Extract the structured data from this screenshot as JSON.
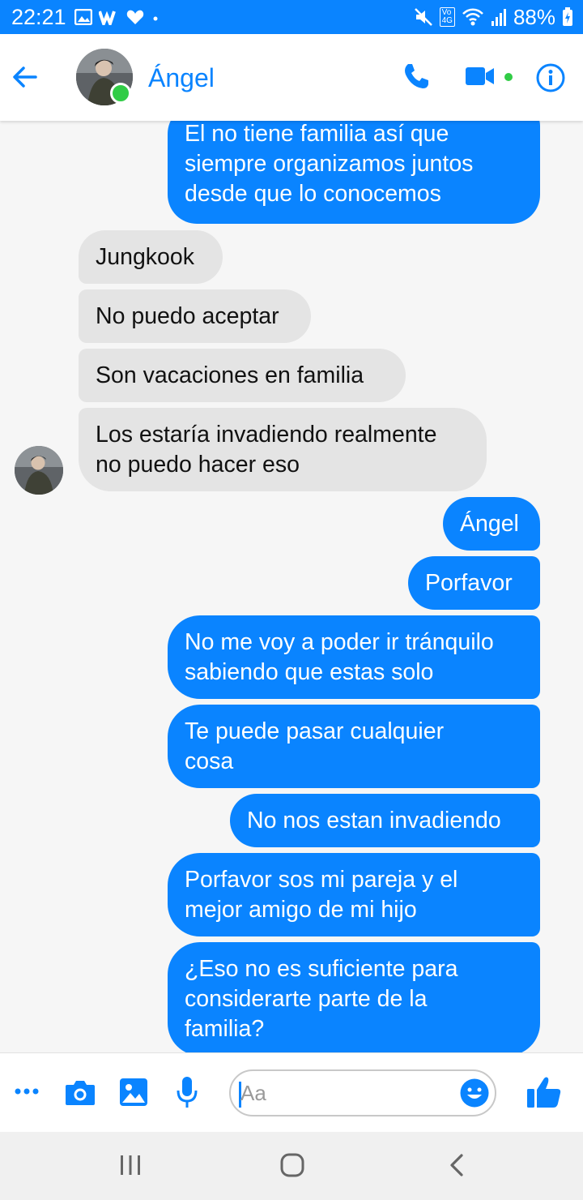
{
  "status_bar": {
    "time": "22:21",
    "battery": "88%",
    "network": "4G",
    "network_sub": "Vo"
  },
  "header": {
    "contact_name": "Ángel",
    "online": true
  },
  "messages": [
    {
      "direction": "outgoing",
      "lines": [
        "El no tiene familia así que",
        "siempre organizamos juntos",
        "desde que lo conocemos"
      ]
    },
    {
      "direction": "incoming",
      "lines": [
        "Jungkook"
      ]
    },
    {
      "direction": "incoming",
      "lines": [
        "No puedo aceptar"
      ]
    },
    {
      "direction": "incoming",
      "lines": [
        "Son vacaciones en familia"
      ]
    },
    {
      "direction": "incoming",
      "lines": [
        "Los estaría invadiendo realmente",
        "no puedo hacer eso"
      ]
    },
    {
      "direction": "outgoing",
      "lines": [
        "Ángel"
      ]
    },
    {
      "direction": "outgoing",
      "lines": [
        "Porfavor"
      ]
    },
    {
      "direction": "outgoing",
      "lines": [
        "No me voy a poder ir tránquilo",
        "sabiendo que estas solo"
      ]
    },
    {
      "direction": "outgoing",
      "lines": [
        "Te puede pasar cualquier",
        "cosa"
      ]
    },
    {
      "direction": "outgoing",
      "lines": [
        "No nos estan invadiendo"
      ]
    },
    {
      "direction": "outgoing",
      "lines": [
        "Porfavor sos mi pareja y el",
        "mejor amigo de mi hijo"
      ]
    },
    {
      "direction": "outgoing",
      "lines": [
        "¿Eso no es suficiente para",
        "considerarte parte de la",
        "familia?"
      ]
    }
  ],
  "composer": {
    "placeholder": "Aa"
  },
  "colors": {
    "accent": "#0a84ff",
    "incoming_bubble": "#e4e4e4",
    "online": "#31cc46"
  },
  "icons": {
    "header": [
      "back-arrow-icon",
      "phone-icon",
      "video-camera-icon",
      "info-icon"
    ],
    "composer": [
      "more-icon",
      "camera-icon",
      "gallery-icon",
      "microphone-icon",
      "emoji-icon",
      "thumbs-up-icon"
    ],
    "nav": [
      "recent-apps-icon",
      "home-icon",
      "back-nav-icon"
    ]
  }
}
